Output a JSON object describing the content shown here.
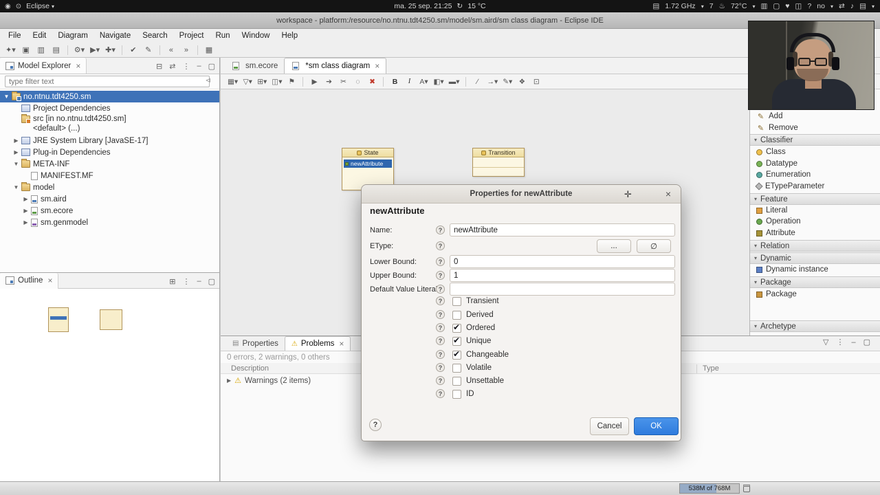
{
  "system_bar": {
    "power_icon": "◉",
    "workspace_icon": "⊙",
    "app_label": "Eclipse",
    "caret_icon": "▾",
    "clock": "ma. 25 sep. 21:25",
    "weather_icon": "↻",
    "weather": "15 °C",
    "tray": [
      {
        "name": "clipboard",
        "glyph": "▤"
      },
      {
        "name": "cpu-frequency",
        "glyph": "1.72 GHz"
      },
      {
        "name": "caret",
        "glyph": "▾"
      },
      {
        "name": "notification-count",
        "glyph": "7"
      },
      {
        "name": "thermometer",
        "glyph": "♨"
      },
      {
        "name": "cpu-temperature",
        "glyph": "72°C"
      },
      {
        "name": "caret",
        "glyph": "▾"
      },
      {
        "name": "windows",
        "glyph": "▥"
      },
      {
        "name": "display",
        "glyph": "▢"
      },
      {
        "name": "heart",
        "glyph": "♥"
      },
      {
        "name": "monitor",
        "glyph": "◫"
      },
      {
        "name": "help",
        "glyph": "?"
      },
      {
        "name": "keyboard-layout",
        "glyph": "no"
      },
      {
        "name": "caret",
        "glyph": "▾"
      },
      {
        "name": "arrows",
        "glyph": "⇄"
      },
      {
        "name": "volume",
        "glyph": "♪"
      },
      {
        "name": "menu",
        "glyph": "▤"
      },
      {
        "name": "caret",
        "glyph": "▾"
      }
    ]
  },
  "window_title": "workspace - platform:/resource/no.ntnu.tdt4250.sm/model/sm.aird/sm class diagram - Eclipse IDE",
  "menu_bar": [
    "File",
    "Edit",
    "Diagram",
    "Navigate",
    "Search",
    "Project",
    "Run",
    "Window",
    "Help"
  ],
  "main_toolbar": [
    {
      "name": "new",
      "glyph": "✦▾"
    },
    {
      "name": "save",
      "glyph": "▣"
    },
    {
      "name": "save-all",
      "glyph": "▥"
    },
    {
      "name": "print",
      "glyph": "▤"
    },
    {
      "name": "debug",
      "glyph": "⚙▾"
    },
    {
      "name": "run",
      "glyph": "▶▾"
    },
    {
      "name": "new-element",
      "glyph": "✚▾"
    },
    {
      "name": "validate",
      "glyph": "✔"
    },
    {
      "name": "edit",
      "glyph": "✎"
    },
    {
      "name": "back",
      "glyph": "«"
    },
    {
      "name": "forward",
      "glyph": "»"
    },
    {
      "name": "perspective",
      "glyph": "▦"
    }
  ],
  "model_explorer": {
    "title": "Model Explorer",
    "close_icon": "×",
    "toolbar": [
      {
        "name": "collapse-all",
        "glyph": "⊟"
      },
      {
        "name": "link-with-editor",
        "glyph": "⇄"
      },
      {
        "name": "view-menu",
        "glyph": "⋮"
      },
      {
        "name": "minimize",
        "glyph": "–"
      },
      {
        "name": "maximize",
        "glyph": "▢"
      }
    ],
    "filter_placeholder": "type filter text",
    "clear_filter_icon": "⊲",
    "tree": [
      {
        "arrow": "▼",
        "label": "no.ntnu.tdt4250.sm"
      },
      {
        "arrow": "",
        "label": "Project Dependencies"
      },
      {
        "arrow": "",
        "label": "src [in no.ntnu.tdt4250.sm]",
        "label2": "<default> (...)"
      },
      {
        "arrow": "▶",
        "label": "JRE System Library [JavaSE-17]"
      },
      {
        "arrow": "▶",
        "label": "Plug-in Dependencies"
      },
      {
        "arrow": "▼",
        "label": "META-INF"
      },
      {
        "arrow": "",
        "label": "MANIFEST.MF"
      },
      {
        "arrow": "▼",
        "label": "model"
      },
      {
        "arrow": "▶",
        "label": "sm.aird"
      },
      {
        "arrow": "▶",
        "label": "sm.ecore"
      },
      {
        "arrow": "▶",
        "label": "sm.genmodel"
      }
    ]
  },
  "outline": {
    "title": "Outline",
    "close_icon": "×",
    "toolbar": [
      {
        "name": "sort",
        "glyph": "⊞"
      },
      {
        "name": "view-menu",
        "glyph": "⋮"
      },
      {
        "name": "minimize",
        "glyph": "–"
      },
      {
        "name": "maximize",
        "glyph": "▢"
      }
    ]
  },
  "editor": {
    "tabs": [
      {
        "label": "sm.ecore"
      },
      {
        "label": "*sm class diagram",
        "close_icon": "×"
      }
    ],
    "stack_toolbar": [
      {
        "name": "minimize",
        "glyph": "–"
      },
      {
        "name": "maximize",
        "glyph": "▢"
      }
    ]
  },
  "diagram_toolbar": [
    {
      "name": "layers",
      "glyph": "▦▾"
    },
    {
      "name": "filters",
      "glyph": "▽▾"
    },
    {
      "name": "concerns",
      "glyph": "⊞▾"
    },
    {
      "name": "show-hide",
      "glyph": "◫▾"
    },
    {
      "name": "pin",
      "glyph": "⚑"
    },
    {
      "name": "select-mode",
      "glyph": "▶"
    },
    {
      "name": "export-image",
      "glyph": "➔"
    },
    {
      "name": "cut",
      "glyph": "✂"
    },
    {
      "name": "hide-element",
      "glyph": "◌"
    },
    {
      "name": "delete-from-model",
      "glyph": "✖"
    },
    {
      "name": "bold",
      "glyph": "B"
    },
    {
      "name": "italic",
      "glyph": "I"
    },
    {
      "name": "font-color",
      "glyph": "A▾"
    },
    {
      "name": "fill-color",
      "glyph": "◧▾"
    },
    {
      "name": "line-color",
      "glyph": "▬▾"
    },
    {
      "name": "line-style",
      "glyph": "∕"
    },
    {
      "name": "arrow-type",
      "glyph": "→▾"
    },
    {
      "name": "apply-style",
      "glyph": "✎▾"
    },
    {
      "name": "arrange",
      "glyph": "❖"
    },
    {
      "name": "snap",
      "glyph": "⊡"
    }
  ],
  "canvas": {
    "state_class": {
      "name": "State",
      "attribute": "newAttribute"
    },
    "transition_class": {
      "name": "Transition"
    }
  },
  "palette": {
    "items": [
      {
        "type": "tool",
        "label": "Add",
        "glyph": "✎"
      },
      {
        "type": "tool",
        "label": "Remove",
        "glyph": "✎"
      },
      {
        "type": "section",
        "label": "Classifier"
      },
      {
        "type": "tool",
        "label": "Class"
      },
      {
        "type": "tool",
        "label": "Datatype"
      },
      {
        "type": "tool",
        "label": "Enumeration"
      },
      {
        "type": "tool",
        "label": "ETypeParameter"
      },
      {
        "type": "section",
        "label": "Feature"
      },
      {
        "type": "tool",
        "label": "Literal"
      },
      {
        "type": "tool",
        "label": "Operation"
      },
      {
        "type": "tool",
        "label": "Attribute"
      },
      {
        "type": "section",
        "label": "Relation"
      },
      {
        "type": "section",
        "label": "Dynamic"
      },
      {
        "type": "tool",
        "label": "Dynamic instance"
      },
      {
        "type": "section",
        "label": "Package"
      },
      {
        "type": "tool",
        "label": "Package"
      },
      {
        "type": "section",
        "label": "Archetype"
      }
    ]
  },
  "dialog": {
    "title": "Properties for newAttribute",
    "close_icon": "×",
    "move_icon": "✛",
    "heading": "newAttribute",
    "fields": [
      {
        "label": "Name:",
        "value": "newAttribute"
      },
      {
        "label": "EType:",
        "value": ""
      },
      {
        "label": "Lower Bound:",
        "value": "0"
      },
      {
        "label": "Upper Bound:",
        "value": "1"
      },
      {
        "label": "Default Value Literal:",
        "value": ""
      }
    ],
    "etype_buttons": [
      "...",
      "∅"
    ],
    "checkboxes": [
      {
        "label": "Transient",
        "checked": false
      },
      {
        "label": "Derived",
        "checked": false
      },
      {
        "label": "Ordered",
        "checked": true
      },
      {
        "label": "Unique",
        "checked": true
      },
      {
        "label": "Changeable",
        "checked": true
      },
      {
        "label": "Volatile",
        "checked": false
      },
      {
        "label": "Unsettable",
        "checked": false
      },
      {
        "label": "ID",
        "checked": false
      }
    ],
    "help_icon": "?",
    "cancel_label": "Cancel",
    "ok_label": "OK"
  },
  "problems_view": {
    "tabs": [
      {
        "label": "Properties",
        "icon": "▤"
      },
      {
        "label": "Problems",
        "icon": "⚠",
        "close_icon": "×"
      }
    ],
    "toolbar": [
      {
        "name": "filter",
        "glyph": "▽"
      },
      {
        "name": "view-menu",
        "glyph": "⋮"
      },
      {
        "name": "minimize",
        "glyph": "–"
      },
      {
        "name": "maximize",
        "glyph": "▢"
      }
    ],
    "summary": "0 errors, 2 warnings, 0 others",
    "columns": [
      "Description",
      "Type"
    ],
    "group_expand_icon": "▶",
    "warning_icon": "⚠",
    "group_row": "Warnings (2 items)"
  },
  "status_bar": {
    "heap": "538M of 768M"
  }
}
